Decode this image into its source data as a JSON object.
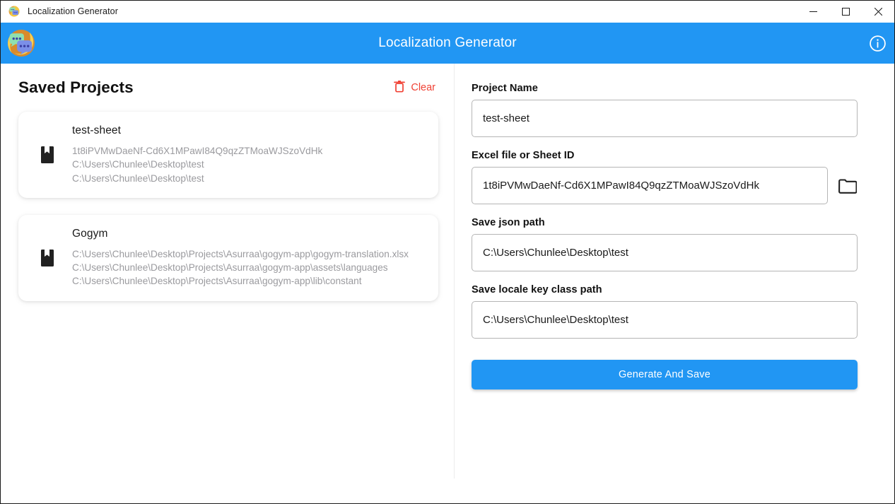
{
  "window": {
    "titlebar_title": "Localization Generator",
    "app_icon": "chat-bubbles-icon",
    "minimize_label": "—",
    "maximize_label": "☐",
    "close_label": "✕"
  },
  "header": {
    "title": "Localization Generator",
    "logo_icon": "chat-bubbles-logo-icon",
    "info_icon": "info-circle-icon",
    "background_color": "#2196F3"
  },
  "left_panel": {
    "title": "Saved Projects",
    "clear_label": "Clear",
    "clear_icon": "trash-icon",
    "clear_color": "#F04134",
    "projects": [
      {
        "icon": "book-icon",
        "name": "test-sheet",
        "lines": [
          "1t8iPVMwDaeNf-Cd6X1MPawI84Q9qzZTMoaWJSzoVdHk",
          "C:\\Users\\Chunlee\\Desktop\\test",
          "C:\\Users\\Chunlee\\Desktop\\test"
        ]
      },
      {
        "icon": "book-icon",
        "name": "Gogym",
        "lines": [
          "C:\\Users\\Chunlee\\Desktop\\Projects\\Asurraa\\gogym-app\\gogym-translation.xlsx",
          "C:\\Users\\Chunlee\\Desktop\\Projects\\Asurraa\\gogym-app\\assets\\languages",
          "C:\\Users\\Chunlee\\Desktop\\Projects\\Asurraa\\gogym-app\\lib\\constant"
        ]
      }
    ]
  },
  "form": {
    "project_name": {
      "label": "Project Name",
      "value": "test-sheet",
      "placeholder": "Project Name"
    },
    "excel_file": {
      "label": "Excel file or Sheet ID",
      "value": "1t8iPVMwDaeNf-Cd6X1MPawI84Q9qzZTMoaWJSzoVdHk",
      "placeholder": "Excel file or Sheet ID",
      "browse_icon": "folder-icon"
    },
    "save_json_path": {
      "label": "Save json path",
      "value": "C:\\Users\\Chunlee\\Desktop\\test",
      "placeholder": "Save json path"
    },
    "save_locale_key_path": {
      "label": "Save locale key class path",
      "value": "C:\\Users\\Chunlee\\Desktop\\test",
      "placeholder": "Save locale key class path"
    },
    "submit_label": "Generate And Save",
    "submit_color": "#2196F3"
  }
}
